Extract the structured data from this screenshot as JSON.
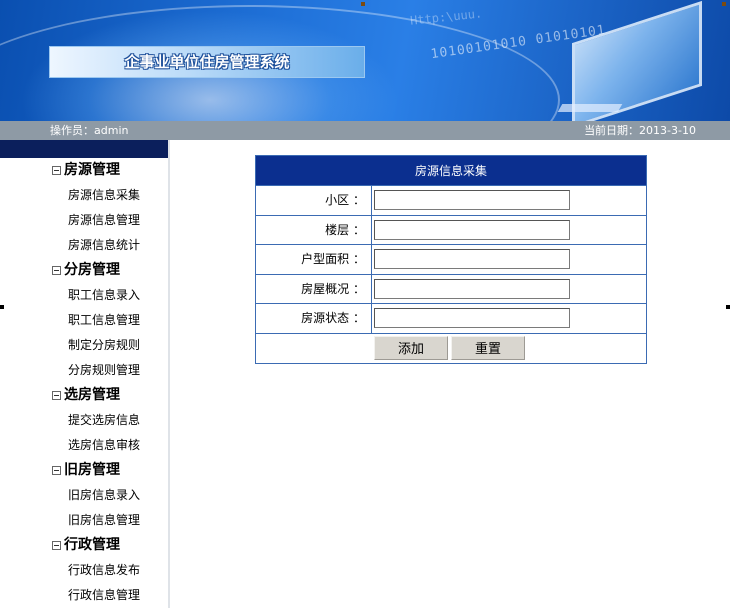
{
  "header": {
    "system_title": "企事业单位住房管理系统",
    "banner_code_1": "Http:\\uuu.",
    "banner_code_2": "10100101010  01010101"
  },
  "infobar": {
    "operator": "操作员：admin",
    "date": "当前日期：2013-3-10"
  },
  "sidebar": {
    "groups": [
      {
        "title": "房源管理",
        "items": [
          "房源信息采集",
          "房源信息管理",
          "房源信息统计"
        ]
      },
      {
        "title": "分房管理",
        "items": [
          "职工信息录入",
          "职工信息管理",
          "制定分房规则",
          "分房规则管理"
        ]
      },
      {
        "title": "选房管理",
        "items": [
          "提交选房信息",
          "选房信息审核"
        ]
      },
      {
        "title": "旧房管理",
        "items": [
          "旧房信息录入",
          "旧房信息管理"
        ]
      },
      {
        "title": "行政管理",
        "items": [
          "行政信息发布",
          "行政信息管理"
        ]
      }
    ]
  },
  "form": {
    "title": "房源信息采集",
    "fields": [
      {
        "label": "小区 ：",
        "value": ""
      },
      {
        "label": "楼层 ：",
        "value": ""
      },
      {
        "label": "户型面积 ：",
        "value": ""
      },
      {
        "label": "房屋概况 ：",
        "value": ""
      },
      {
        "label": "房源状态 ：",
        "value": ""
      }
    ],
    "add_label": "添加",
    "reset_label": "重置"
  },
  "colors": {
    "banner_blue": "#1e6fd6",
    "header_navy": "#0b2f8f",
    "infobar_gray": "#8e9aa5",
    "table_border": "#3b6bb3"
  }
}
